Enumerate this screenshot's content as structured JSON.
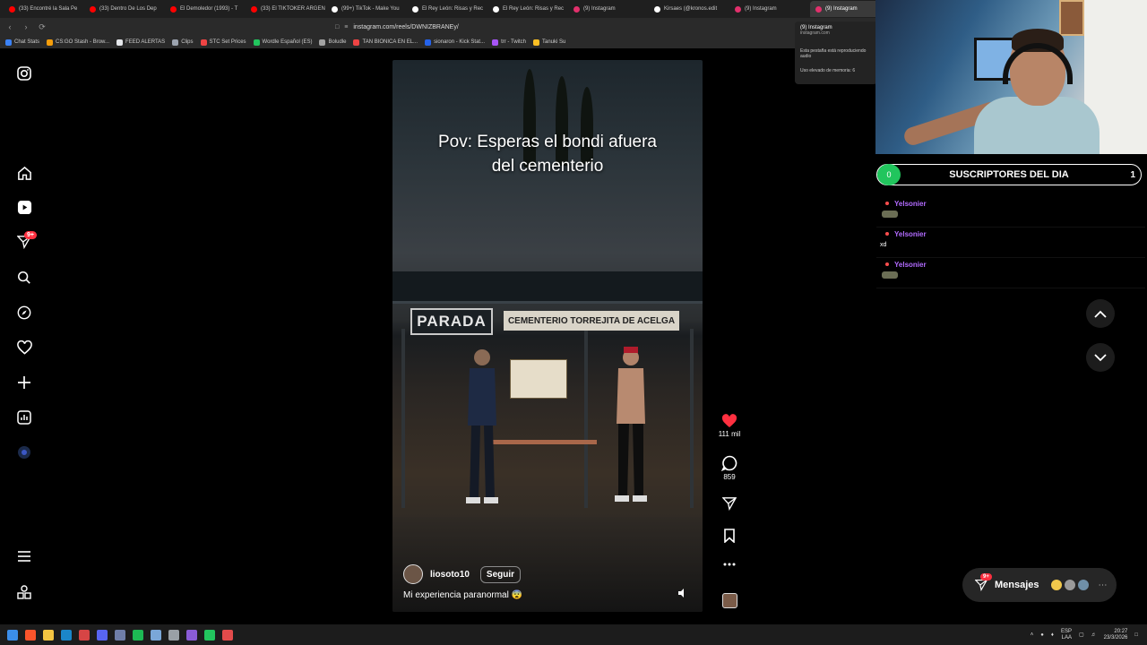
{
  "browser": {
    "tabs": [
      {
        "label": "(33) Encontré la Sala Pe",
        "color": "#ff0000"
      },
      {
        "label": "(33) Dentro De Los Dep",
        "color": "#ff0000"
      },
      {
        "label": "El Demoledor (1993) - T",
        "color": "#ff0000"
      },
      {
        "label": "(33) El TIKTOKER ARGEN",
        "color": "#ff0000"
      },
      {
        "label": "(99+) TikTok - Make You",
        "color": "#ffffff"
      },
      {
        "label": "El Rey León: Risas y Rec",
        "color": "#ffffff"
      },
      {
        "label": "El Rey León: Risas y Rec",
        "color": "#ffffff"
      },
      {
        "label": "(9) Instagram",
        "color": "#e1306c"
      },
      {
        "label": "Kirsaes (@kronos.edit",
        "color": "#ffffff"
      },
      {
        "label": "(9) Instagram",
        "color": "#e1306c"
      },
      {
        "label": "(9) Instagram",
        "color": "#e1306c"
      }
    ],
    "url": "instagram.com/reels/DWNIZBRANEy/",
    "bookmarks": [
      "Chat Stats",
      "CS:GO Stash - Brow...",
      "FEED ALERTAS",
      "Clips",
      "STC Set Prices",
      "Wordle Español (ES)",
      "Boludle",
      "TAN BIONICA EN EL...",
      "sionaron - Kick Stat...",
      "trr - Twitch",
      "Tanuki Su"
    ],
    "tab_popup": {
      "title": "(9) Instagram",
      "domain": "instagram.com",
      "line1": "Esta pestaña está reproduciendo audio",
      "line2": "Uso elevado de memoria: 6"
    }
  },
  "reel": {
    "title_line1": "Pov: Esperas el bondi afuera",
    "title_line2": "del cementerio",
    "sign_parada": "PARADA",
    "sign_cementerio": "CEMENTERIO TORREJITA DE ACELGA",
    "author": "liosoto10",
    "follow_label": "Seguir",
    "caption": "Mi experiencia paranormal 😨"
  },
  "actions": {
    "likes": "111 mil",
    "comments": "859"
  },
  "sidebar": {
    "notification_badge": "9+"
  },
  "subs": {
    "title": "SUSCRIPTORES DEL DIA",
    "left_count": "0",
    "right_count": "1"
  },
  "chat": [
    {
      "name": "Yelsonier",
      "message": ""
    },
    {
      "name": "Yelsonier",
      "message": "xd"
    },
    {
      "name": "Yelsonier",
      "message": ""
    }
  ],
  "messages": {
    "label": "Mensajes",
    "badge": "9+"
  },
  "taskbar": {
    "lang_top": "ESP",
    "lang_bottom": "LAA",
    "time": "20:27",
    "date": "23/3/2026"
  },
  "colors": {
    "like_red": "#ff3040",
    "chat_name": "#b26bff",
    "subs_green": "#21c55d"
  }
}
